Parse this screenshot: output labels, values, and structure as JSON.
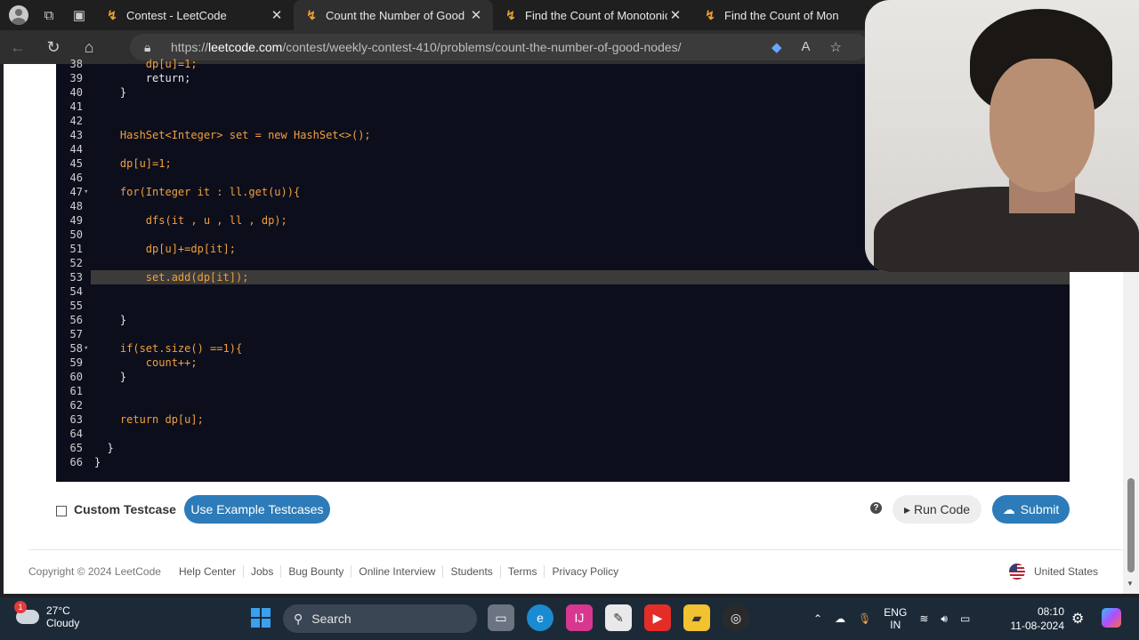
{
  "browser": {
    "tabs": [
      {
        "title": "Contest - LeetCode",
        "active": false
      },
      {
        "title": "Count the Number of Good No",
        "active": true
      },
      {
        "title": "Find the Count of Monotonic Pa",
        "active": false
      },
      {
        "title": "Find the Count of Mon",
        "active": false
      }
    ],
    "url_prefix": "https://",
    "url_host": "leetcode.com",
    "url_path": "/contest/weekly-contest-410/problems/count-the-number-of-good-nodes/"
  },
  "editor": {
    "highlighted_line": 53,
    "lines": [
      {
        "n": "38",
        "fold": "",
        "code": "        dp[u]=1;"
      },
      {
        "n": "39",
        "fold": "",
        "code": "        return;"
      },
      {
        "n": "40",
        "fold": "",
        "code": "    }"
      },
      {
        "n": "41",
        "fold": "",
        "code": ""
      },
      {
        "n": "42",
        "fold": "",
        "code": ""
      },
      {
        "n": "43",
        "fold": "",
        "code": "    HashSet<Integer> set = new HashSet<>();"
      },
      {
        "n": "44",
        "fold": "",
        "code": ""
      },
      {
        "n": "45",
        "fold": "",
        "code": "    dp[u]=1;"
      },
      {
        "n": "46",
        "fold": "",
        "code": ""
      },
      {
        "n": "47",
        "fold": "▾",
        "code": "    for(Integer it : ll.get(u)){"
      },
      {
        "n": "48",
        "fold": "",
        "code": ""
      },
      {
        "n": "49",
        "fold": "",
        "code": "        dfs(it , u , ll , dp);"
      },
      {
        "n": "50",
        "fold": "",
        "code": ""
      },
      {
        "n": "51",
        "fold": "",
        "code": "        dp[u]+=dp[it];"
      },
      {
        "n": "52",
        "fold": "",
        "code": ""
      },
      {
        "n": "53",
        "fold": "",
        "code": "        set.add(dp[it]);"
      },
      {
        "n": "54",
        "fold": "",
        "code": ""
      },
      {
        "n": "55",
        "fold": "",
        "code": ""
      },
      {
        "n": "56",
        "fold": "",
        "code": "    }"
      },
      {
        "n": "57",
        "fold": "",
        "code": ""
      },
      {
        "n": "58",
        "fold": "▾",
        "code": "    if(set.size() ==1){"
      },
      {
        "n": "59",
        "fold": "",
        "code": "        count++;"
      },
      {
        "n": "60",
        "fold": "",
        "code": "    }"
      },
      {
        "n": "61",
        "fold": "",
        "code": ""
      },
      {
        "n": "62",
        "fold": "",
        "code": ""
      },
      {
        "n": "63",
        "fold": "",
        "code": "    return dp[u];"
      },
      {
        "n": "64",
        "fold": "",
        "code": ""
      },
      {
        "n": "65",
        "fold": "",
        "code": "  }"
      },
      {
        "n": "66",
        "fold": "",
        "code": "}"
      }
    ]
  },
  "controls": {
    "custom_testcase_label": "Custom Testcase",
    "example_button": "Use Example Testcases",
    "help": "?",
    "run_button": "Run Code",
    "submit_button": "Submit"
  },
  "footer": {
    "copyright": "Copyright © 2024 LeetCode",
    "links": [
      "Help Center",
      "Jobs",
      "Bug Bounty",
      "Online Interview",
      "Students",
      "Terms",
      "Privacy Policy"
    ],
    "country": "United States"
  },
  "taskbar": {
    "weather_badge": "1",
    "temperature": "27°C",
    "condition": "Cloudy",
    "search_label": "Search",
    "lang_line1": "ENG",
    "lang_line2": "IN",
    "time": "08:10",
    "date": "11-08-2024"
  },
  "colors": {
    "editor_bg": "#0d0e1c",
    "accent_button": "#2d7bb8",
    "taskbar_bg": "#1c2a38"
  }
}
